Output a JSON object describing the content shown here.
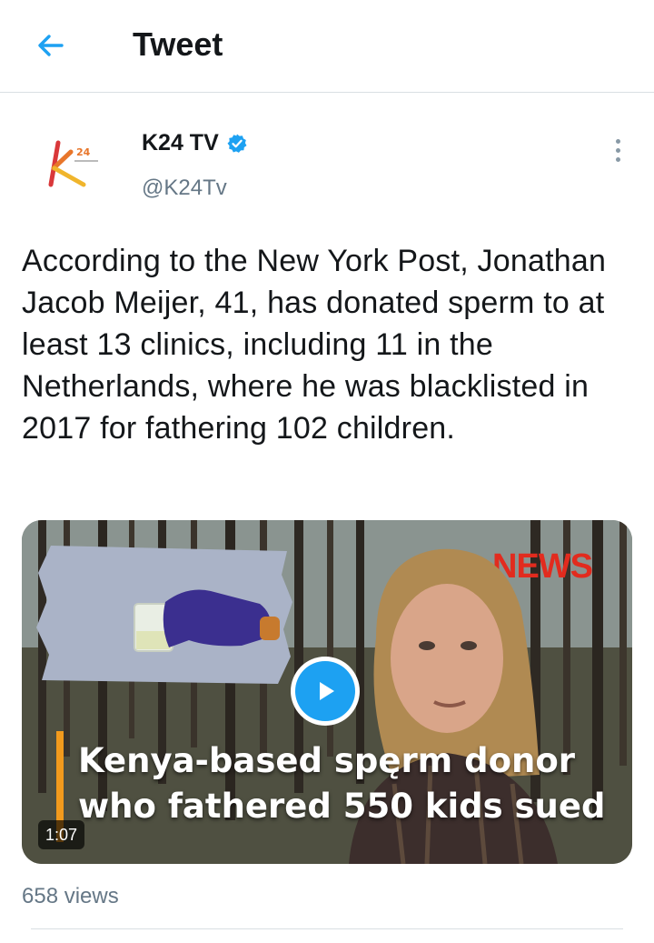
{
  "header": {
    "title": "Tweet",
    "back_icon": "arrow-left-icon",
    "accent_color": "#1da1f2"
  },
  "author": {
    "name": "K24 TV",
    "handle": "@K24Tv",
    "verified": true,
    "avatar_logo_text": "K24"
  },
  "tweet": {
    "text": "According to the New York Post, Jonathan Jacob Meijer, 41, has donated sperm to at least 13 clinics, including 11 in the Netherlands, where he was blacklisted in 2017 for fathering 102 children."
  },
  "media": {
    "news_tag": "NEWS",
    "caption_line1": "Kenya-based spęrm donor",
    "caption_line2": "who fathered 550 kids sued",
    "duration": "1:07",
    "play_icon": "play-icon"
  },
  "stats": {
    "views": "658 views"
  }
}
